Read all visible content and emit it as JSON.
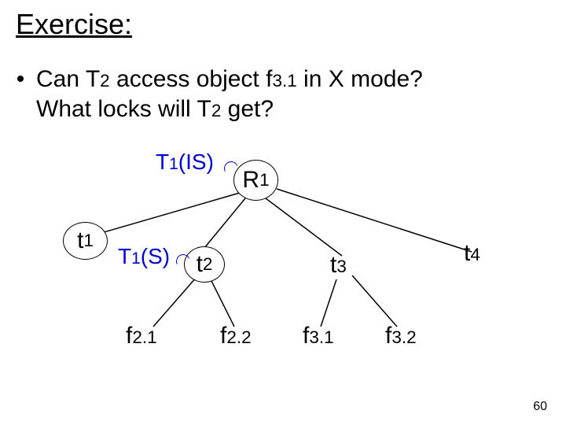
{
  "title": "Exercise:",
  "question": {
    "pre1": "Can T",
    "t2a": "2",
    "mid1": " access object f",
    "f31": "3.1",
    "post1": " in X mode?",
    "line2_pre": "What locks will T",
    "t2b": "2",
    "line2_post": " get?"
  },
  "locks": {
    "r1_pre": "T",
    "r1_sub": "1",
    "r1_post": "(IS)",
    "t2_pre": "T",
    "t2_sub": "1",
    "t2_post": "(S)"
  },
  "nodes": {
    "R1_pre": "R",
    "R1_sub": "1",
    "t1_pre": "t",
    "t1_sub": "1",
    "t2_pre": "t",
    "t2_sub": "2",
    "t3_pre": "t",
    "t3_sub": "3",
    "t4_pre": "t",
    "t4_sub": "4",
    "f21_pre": "f",
    "f21_sub": "2.1",
    "f22_pre": "f",
    "f22_sub": "2.2",
    "f31_pre": "f",
    "f31_sub": "3.1",
    "f32_pre": "f",
    "f32_sub": "3.2"
  },
  "page": "60"
}
